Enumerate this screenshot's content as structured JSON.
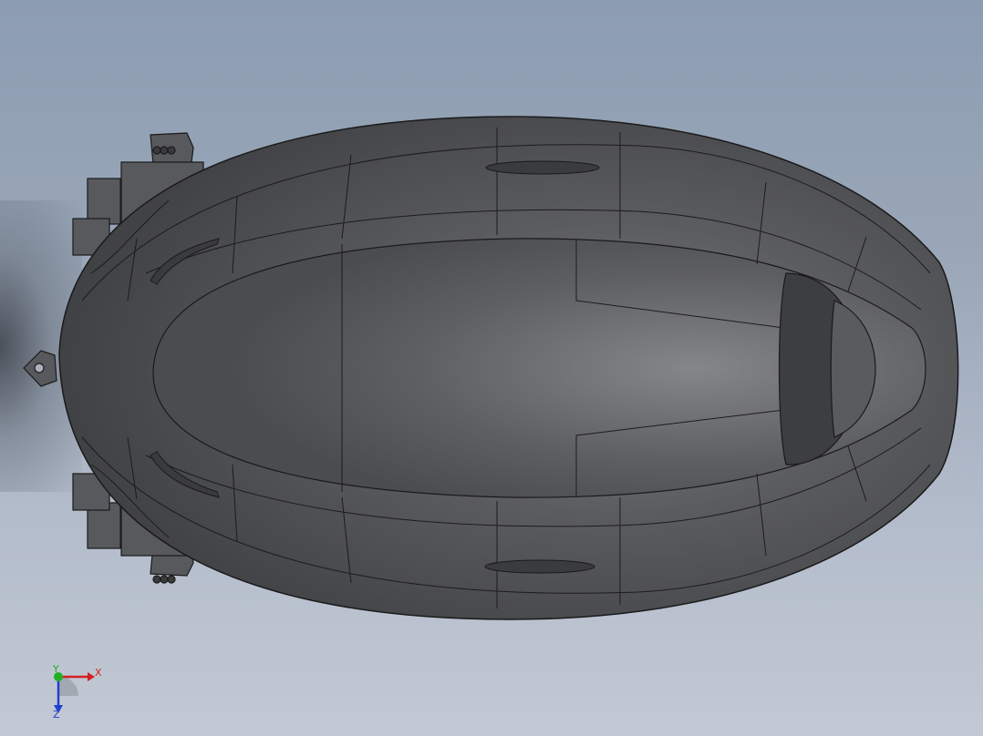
{
  "viewport": {
    "background_top": "#8c9cb1",
    "background_bottom": "#c2c9d4",
    "model_color": "#505052",
    "edge_color": "#1a1a1a"
  },
  "triad": {
    "x_label": "X",
    "y_label": "Y",
    "z_label": "Z",
    "x_color": "#d42020",
    "y_color": "#20b020",
    "z_color": "#2040d0"
  }
}
